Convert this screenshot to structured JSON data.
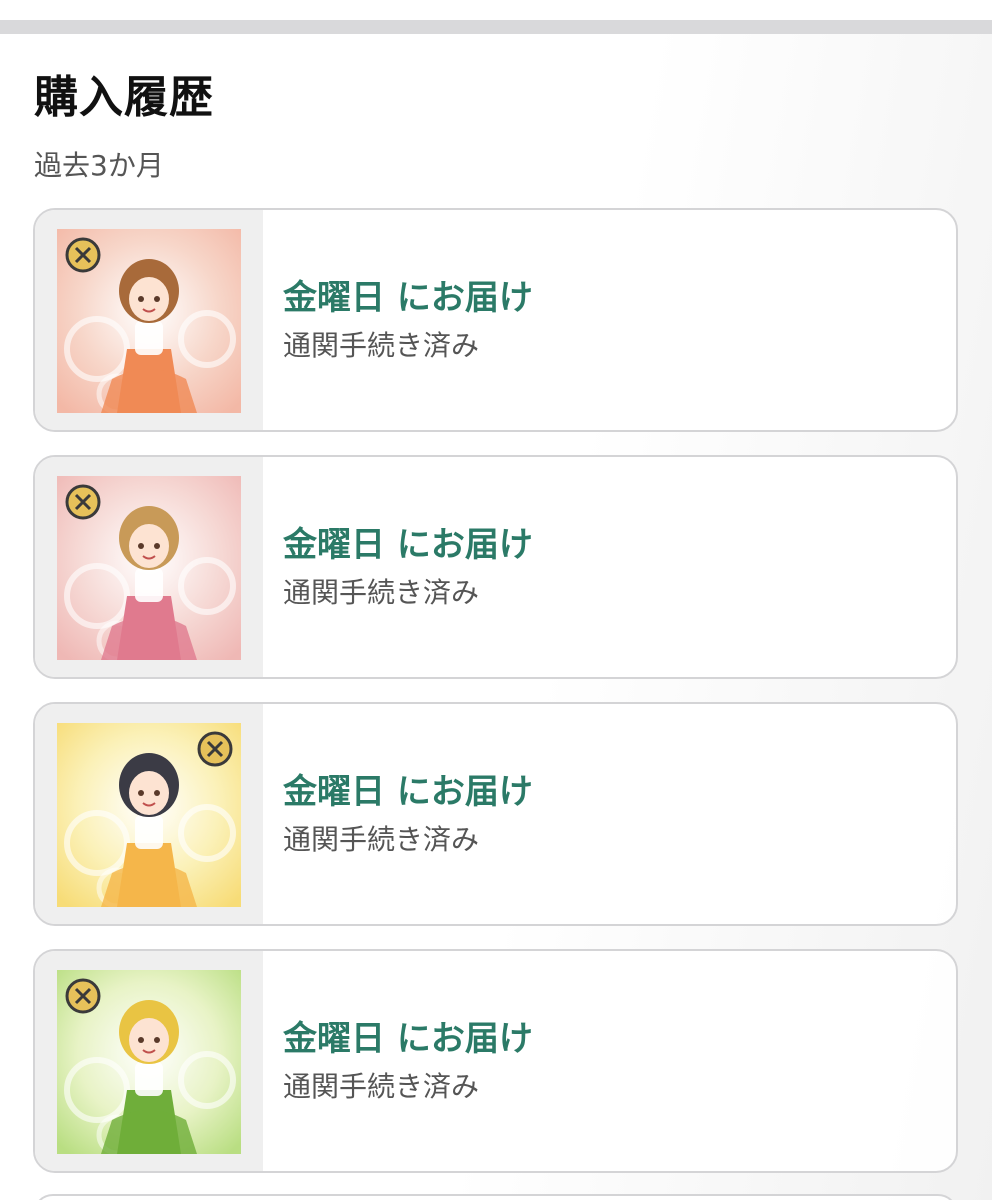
{
  "header": {
    "title": "購入履歴",
    "period": "過去3か月"
  },
  "orders": [
    {
      "delivery": "金曜日 にお届け",
      "status": "通関手続き済み",
      "thumbnail": "album-cover-orange",
      "colors": {
        "bg1": "#f7d6c9",
        "bg2": "#f3b8a6",
        "dress": "#f08a55",
        "hair": "#a86a3a"
      }
    },
    {
      "delivery": "金曜日 にお届け",
      "status": "通関手続き済み",
      "thumbnail": "album-cover-pink",
      "colors": {
        "bg1": "#f6d9d5",
        "bg2": "#efb8b5",
        "dress": "#e07a8e",
        "hair": "#c89a58"
      }
    },
    {
      "delivery": "金曜日 にお届け",
      "status": "通関手続き済み",
      "thumbnail": "album-cover-yellow",
      "colors": {
        "bg1": "#fbf1b8",
        "bg2": "#f7dc77",
        "dress": "#f5b64a",
        "hair": "#3b3b45"
      }
    },
    {
      "delivery": "金曜日 にお届け",
      "status": "通関手続き済み",
      "thumbnail": "album-cover-green",
      "colors": {
        "bg1": "#e8f3c6",
        "bg2": "#b9de82",
        "dress": "#6fae3a",
        "hair": "#e9c443"
      }
    }
  ],
  "theme": {
    "accent": "#2b7a67",
    "text": "#111111",
    "muted": "#555555",
    "border": "#d4d4d6"
  }
}
